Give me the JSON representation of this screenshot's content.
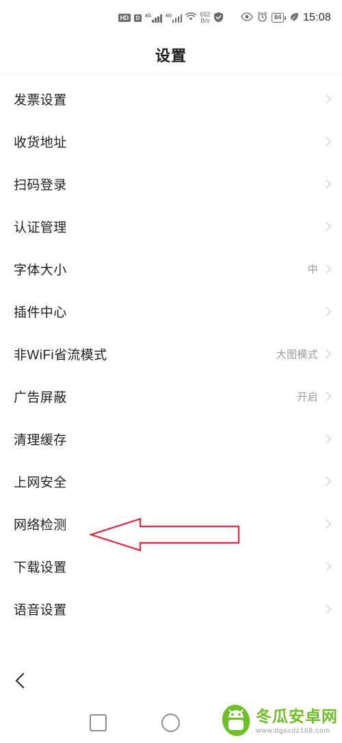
{
  "status_bar": {
    "hd_label": "HD",
    "volte_label": "D",
    "network_gen_1": "4G",
    "network_gen_2": "4G",
    "speed_value": "652",
    "speed_unit": "B/s",
    "shield_icon": "shield-check-icon",
    "wifi_icon": "wifi-icon",
    "eye_icon": "eye-icon",
    "alarm_icon": "alarm-clock-icon",
    "battery_level": "84",
    "power_saving_icon": "leaf-icon",
    "time": "15:08"
  },
  "header": {
    "title": "设置"
  },
  "list": {
    "items": [
      {
        "label": "发票设置",
        "value": "",
        "chevron": "chevron-right-icon"
      },
      {
        "label": "收货地址",
        "value": "",
        "chevron": "chevron-right-icon"
      },
      {
        "label": "扫码登录",
        "value": "",
        "chevron": "chevron-right-icon"
      },
      {
        "label": "认证管理",
        "value": "",
        "chevron": "chevron-right-icon"
      },
      {
        "label": "字体大小",
        "value": "中",
        "chevron": "chevron-right-icon"
      },
      {
        "label": "插件中心",
        "value": "",
        "chevron": "chevron-right-icon"
      },
      {
        "label": "非WiFi省流模式",
        "value": "大图模式",
        "chevron": "chevron-right-icon"
      },
      {
        "label": "广告屏蔽",
        "value": "开启",
        "chevron": "chevron-right-icon"
      },
      {
        "label": "清理缓存",
        "value": "",
        "chevron": "chevron-right-icon"
      },
      {
        "label": "上网安全",
        "value": "",
        "chevron": "chevron-right-icon"
      },
      {
        "label": "网络检测",
        "value": "",
        "chevron": "chevron-right-icon"
      },
      {
        "label": "下载设置",
        "value": "",
        "chevron": "chevron-right-icon"
      },
      {
        "label": "语音设置",
        "value": "",
        "chevron": "chevron-right-icon"
      }
    ]
  },
  "annotation": {
    "type": "left-pointing-arrow",
    "color": "#d6344a",
    "target_label": "网络检测"
  },
  "bottom": {
    "back_icon": "back-chevron-icon",
    "recents_icon": "square-recents-icon",
    "home_icon": "circle-home-icon"
  },
  "watermark": {
    "site_name": "冬瓜安卓网",
    "url": "www.dgxcdz168.com",
    "logo_icon": "winter-melon-android-logo",
    "logo_color": "#6fbe2a"
  }
}
